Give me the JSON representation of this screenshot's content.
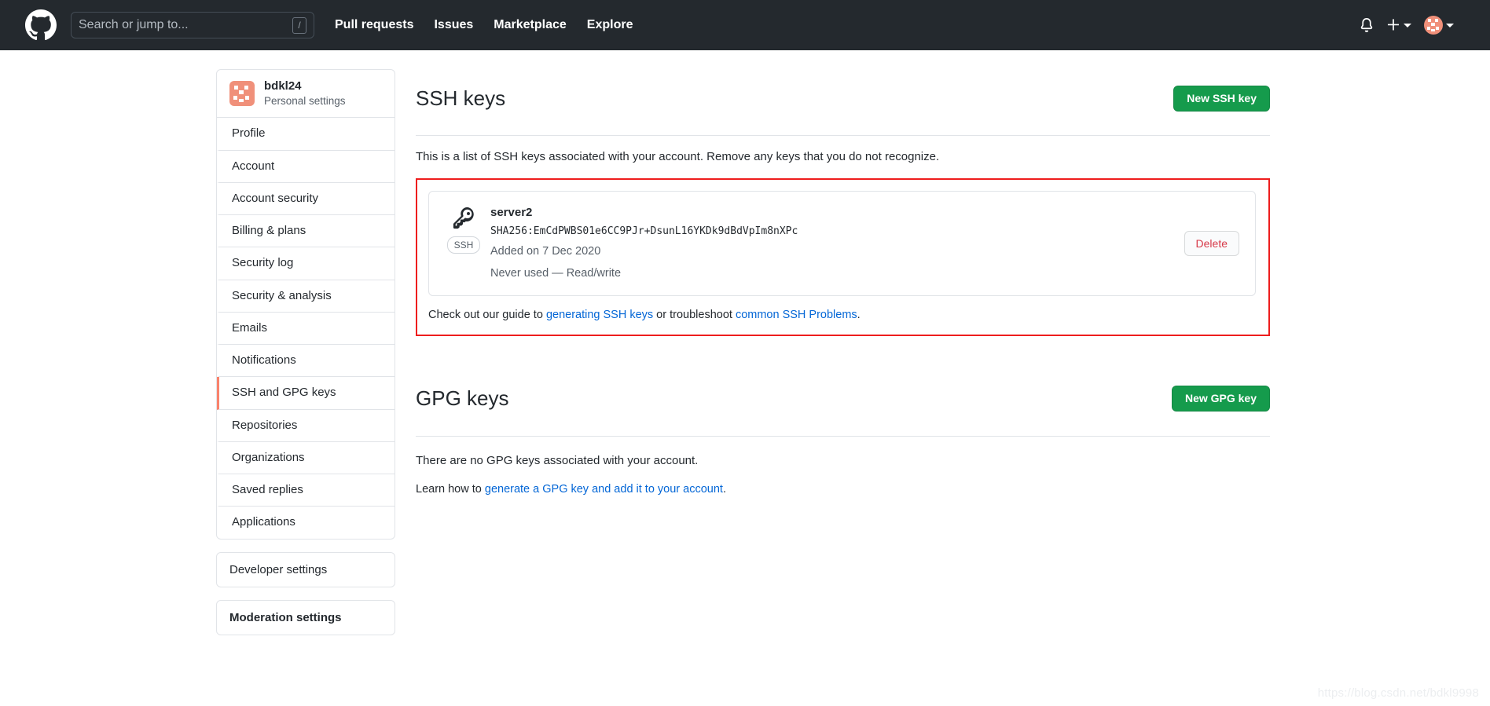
{
  "header": {
    "logo_icon": "github-mark-icon",
    "search": {
      "placeholder": "Search or jump to...",
      "shortcut_key": "/"
    },
    "nav": [
      {
        "label": "Pull requests"
      },
      {
        "label": "Issues"
      },
      {
        "label": "Marketplace"
      },
      {
        "label": "Explore"
      }
    ],
    "icons": {
      "notifications": "bell-icon",
      "create_new": "plus-icon",
      "create_new_caret": "chevron-down-icon",
      "avatar": "user-avatar",
      "avatar_caret": "chevron-down-icon"
    },
    "bg_color": "#24292e"
  },
  "sidebar": {
    "profile": {
      "name": "bdkl24",
      "subtitle": "Personal settings",
      "avatar_icon": "user-avatar"
    },
    "items": [
      {
        "label": "Profile",
        "active": false
      },
      {
        "label": "Account",
        "active": false
      },
      {
        "label": "Account security",
        "active": false
      },
      {
        "label": "Billing & plans",
        "active": false
      },
      {
        "label": "Security log",
        "active": false
      },
      {
        "label": "Security & analysis",
        "active": false
      },
      {
        "label": "Emails",
        "active": false
      },
      {
        "label": "Notifications",
        "active": false
      },
      {
        "label": "SSH and GPG keys",
        "active": true
      },
      {
        "label": "Repositories",
        "active": false
      },
      {
        "label": "Organizations",
        "active": false
      },
      {
        "label": "Saved replies",
        "active": false
      },
      {
        "label": "Applications",
        "active": false
      }
    ],
    "developer_settings": "Developer settings",
    "moderation_settings": "Moderation settings",
    "active_accent_color": "#f9826c"
  },
  "ssh_section": {
    "title": "SSH keys",
    "new_button": "New SSH key",
    "description": "This is a list of SSH keys associated with your account. Remove any keys that you do not recognize.",
    "key": {
      "icon": "key-icon",
      "badge": "SSH",
      "title": "server2",
      "fingerprint": "SHA256:EmCdPWBS01e6CC9PJr+DsunL16YKDk9dBdVpIm8nXPc",
      "added": "Added on 7 Dec 2020",
      "usage": "Never used — Read/write",
      "delete_button": "Delete"
    },
    "guide": {
      "prefix": "Check out our guide to ",
      "link1": "generating SSH keys",
      "middle": " or troubleshoot ",
      "link2": "common SSH Problems",
      "suffix": "."
    },
    "highlight_color": "#ee1d1d"
  },
  "gpg_section": {
    "title": "GPG keys",
    "new_button": "New GPG key",
    "empty_text": "There are no GPG keys associated with your account.",
    "learn": {
      "prefix": "Learn how to ",
      "link": "generate a GPG key and add it to your account",
      "suffix": "."
    }
  },
  "watermark": "https://blog.csdn.net/bdkl9998",
  "colors": {
    "green_button": "#159b4c",
    "link": "#0366d6",
    "delete_text": "#d73a49"
  }
}
